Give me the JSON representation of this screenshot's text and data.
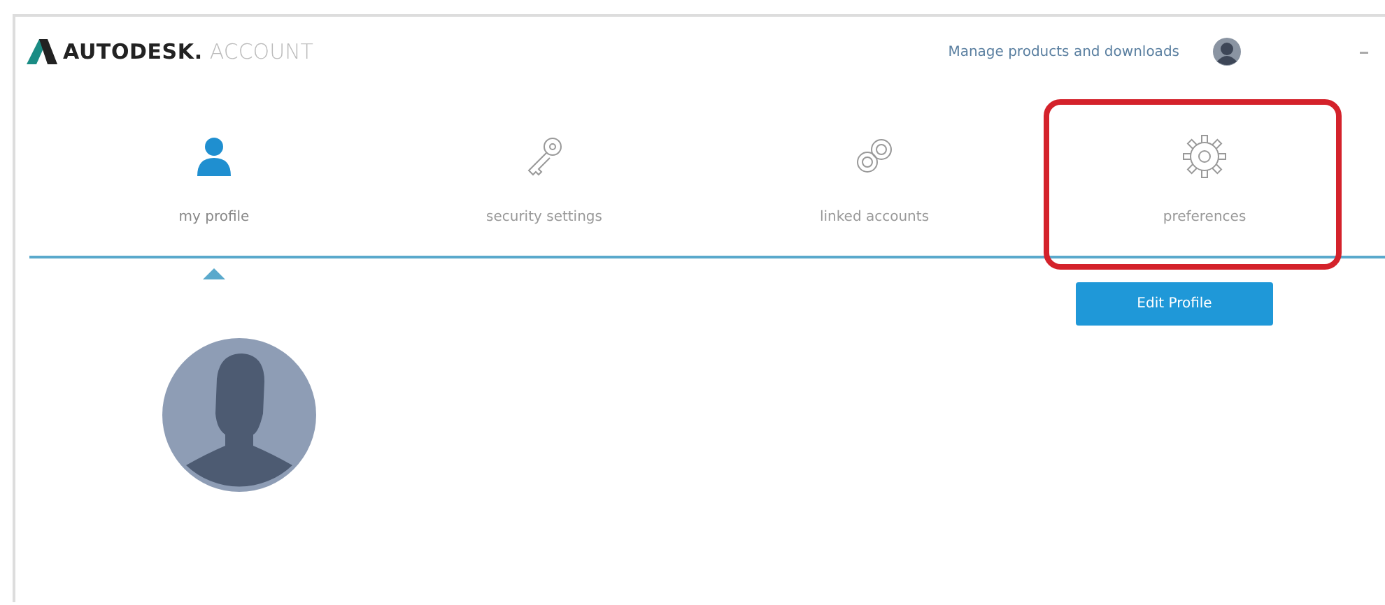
{
  "header": {
    "brand": "AUTODESK.",
    "product": "ACCOUNT",
    "link": "Manage products and downloads"
  },
  "tabs": [
    {
      "label": "my profile",
      "kind": "person",
      "selected": true,
      "highlighted": false
    },
    {
      "label": "security settings",
      "kind": "key",
      "selected": false,
      "highlighted": false
    },
    {
      "label": "linked accounts",
      "kind": "link",
      "selected": false,
      "highlighted": false
    },
    {
      "label": "preferences",
      "kind": "gear",
      "selected": false,
      "highlighted": true
    }
  ],
  "profile": {
    "button": "Edit Profile"
  }
}
